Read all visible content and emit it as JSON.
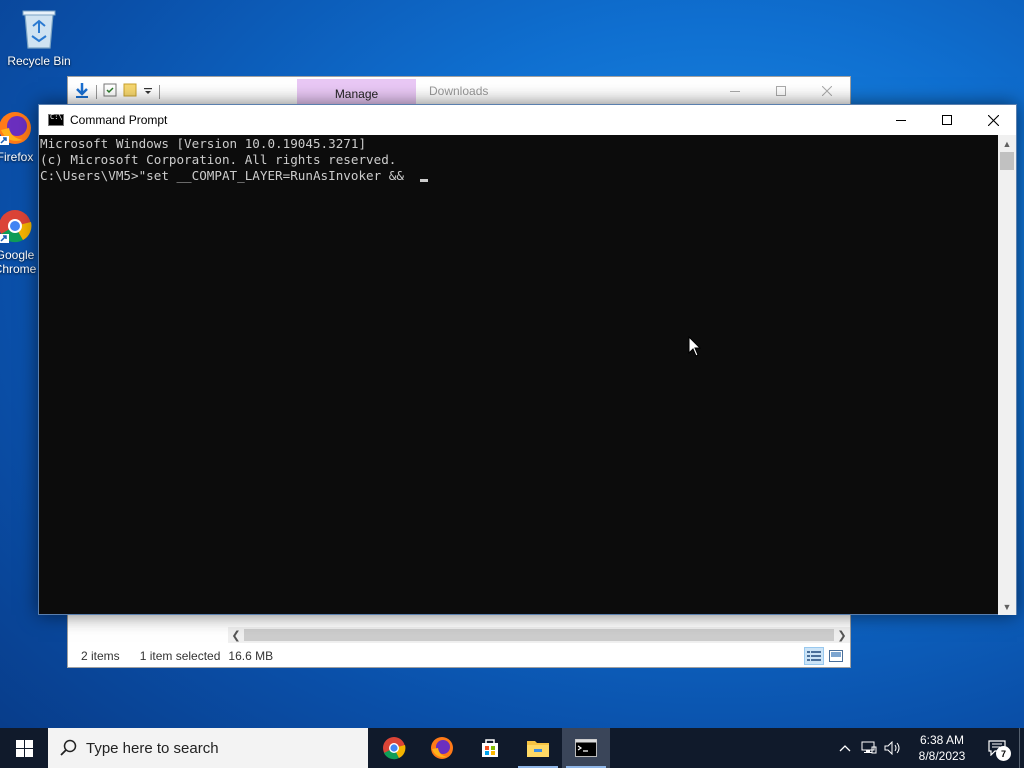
{
  "desktop": {
    "icons": [
      {
        "label": "Recycle Bin"
      },
      {
        "label": "Firefox"
      },
      {
        "label": "Google Chrome"
      }
    ]
  },
  "explorer": {
    "context_tab": "Manage",
    "title": "Downloads",
    "status": {
      "items": "2 items",
      "selected": "1 item selected",
      "size": "16.6 MB"
    }
  },
  "cmd": {
    "title": "Command Prompt",
    "lines": [
      "Microsoft Windows [Version 10.0.19045.3271]",
      "(c) Microsoft Corporation. All rights reserved.",
      "",
      "C:\\Users\\VM5>\"set __COMPAT_LAYER=RunAsInvoker && "
    ]
  },
  "taskbar": {
    "search_placeholder": "Type here to search",
    "apps": [
      "chrome-icon",
      "firefox-icon",
      "store-icon",
      "file-explorer-icon",
      "command-prompt-icon"
    ],
    "clock": {
      "time": "6:38 AM",
      "date": "8/8/2023"
    },
    "notification_count": "7"
  },
  "colors": {
    "desktop_bg": "#0f6fd0",
    "taskbar_bg": "#101a2b",
    "console_bg": "#0c0c0c",
    "console_fg": "#cccccc",
    "manage_tab": "#e9c8f5"
  }
}
